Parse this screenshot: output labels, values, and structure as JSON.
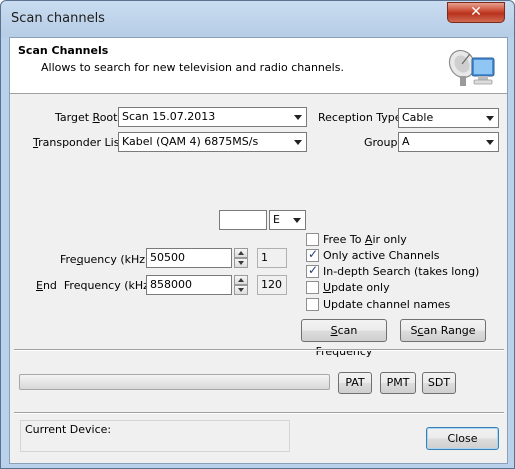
{
  "window": {
    "title": "Scan channels",
    "close_glyph": "✕"
  },
  "header": {
    "title": "Scan Channels",
    "subtitle": "Allows to search for new television and radio channels.",
    "icon": "satellite-dish-computer-icon"
  },
  "form": {
    "target_root": {
      "label_pre": "Target ",
      "label_u": "R",
      "label_post": "oot",
      "value": "Scan 15.07.2013"
    },
    "transponder_list": {
      "label_pre": "",
      "label_u": "T",
      "label_post": "ransponder List",
      "value": "Kabel (QAM 4) 6875MS/s"
    },
    "reception_type": {
      "label": "Reception Type",
      "value": "Cable"
    },
    "group": {
      "label": "Group",
      "value": "A"
    },
    "unit_input": {
      "value": ""
    },
    "unit_select": {
      "value": "E"
    },
    "frequency": {
      "label_pre": "Fre",
      "label_u": "q",
      "label_post": "uency (kHz)",
      "value": "50500",
      "step": "1"
    },
    "end_frequency": {
      "label_pre": "",
      "label_u": "E",
      "label_post": "nd  Frequency (kHz)",
      "value": "858000",
      "step": "120"
    }
  },
  "options": [
    {
      "pre": "Free To ",
      "u": "A",
      "post": "ir only",
      "checked": false
    },
    {
      "pre": "Only active Channels",
      "u": "",
      "post": "",
      "checked": true
    },
    {
      "pre": "In-depth Search (takes long)",
      "u": "",
      "post": "",
      "checked": true
    },
    {
      "pre": "",
      "u": "U",
      "post": "pdate only",
      "checked": false
    },
    {
      "pre": "Update channel names",
      "u": "",
      "post": "",
      "checked": false
    }
  ],
  "buttons": {
    "scan_frequency": {
      "pre": "",
      "u": "S",
      "post": "can Frequency"
    },
    "scan_range": {
      "pre": "S",
      "u": "c",
      "post": "an Range"
    },
    "pat": "PAT",
    "pmt": "PMT",
    "sdt": "SDT",
    "close": "Close"
  },
  "progress": {
    "value": 0
  },
  "device": {
    "label": "Current Device:",
    "value": ""
  }
}
